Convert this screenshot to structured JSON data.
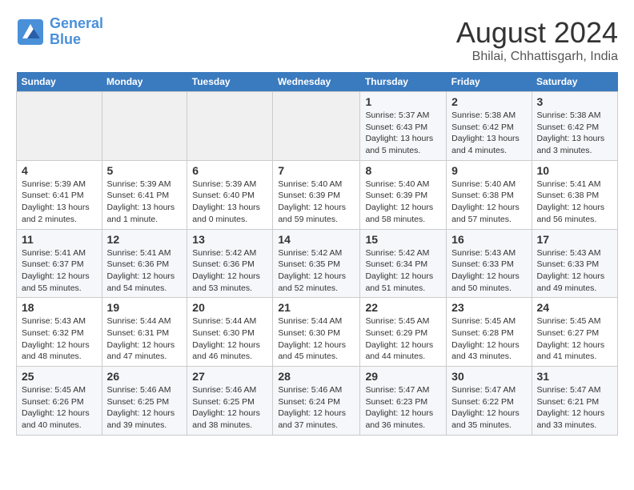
{
  "header": {
    "logo_line1": "General",
    "logo_line2": "Blue",
    "title": "August 2024",
    "subtitle": "Bhilai, Chhattisgarh, India"
  },
  "days_of_week": [
    "Sunday",
    "Monday",
    "Tuesday",
    "Wednesday",
    "Thursday",
    "Friday",
    "Saturday"
  ],
  "weeks": [
    [
      {
        "day": "",
        "info": ""
      },
      {
        "day": "",
        "info": ""
      },
      {
        "day": "",
        "info": ""
      },
      {
        "day": "",
        "info": ""
      },
      {
        "day": "1",
        "info": "Sunrise: 5:37 AM\nSunset: 6:43 PM\nDaylight: 13 hours\nand 5 minutes."
      },
      {
        "day": "2",
        "info": "Sunrise: 5:38 AM\nSunset: 6:42 PM\nDaylight: 13 hours\nand 4 minutes."
      },
      {
        "day": "3",
        "info": "Sunrise: 5:38 AM\nSunset: 6:42 PM\nDaylight: 13 hours\nand 3 minutes."
      }
    ],
    [
      {
        "day": "4",
        "info": "Sunrise: 5:39 AM\nSunset: 6:41 PM\nDaylight: 13 hours\nand 2 minutes."
      },
      {
        "day": "5",
        "info": "Sunrise: 5:39 AM\nSunset: 6:41 PM\nDaylight: 13 hours\nand 1 minute."
      },
      {
        "day": "6",
        "info": "Sunrise: 5:39 AM\nSunset: 6:40 PM\nDaylight: 13 hours\nand 0 minutes."
      },
      {
        "day": "7",
        "info": "Sunrise: 5:40 AM\nSunset: 6:39 PM\nDaylight: 12 hours\nand 59 minutes."
      },
      {
        "day": "8",
        "info": "Sunrise: 5:40 AM\nSunset: 6:39 PM\nDaylight: 12 hours\nand 58 minutes."
      },
      {
        "day": "9",
        "info": "Sunrise: 5:40 AM\nSunset: 6:38 PM\nDaylight: 12 hours\nand 57 minutes."
      },
      {
        "day": "10",
        "info": "Sunrise: 5:41 AM\nSunset: 6:38 PM\nDaylight: 12 hours\nand 56 minutes."
      }
    ],
    [
      {
        "day": "11",
        "info": "Sunrise: 5:41 AM\nSunset: 6:37 PM\nDaylight: 12 hours\nand 55 minutes."
      },
      {
        "day": "12",
        "info": "Sunrise: 5:41 AM\nSunset: 6:36 PM\nDaylight: 12 hours\nand 54 minutes."
      },
      {
        "day": "13",
        "info": "Sunrise: 5:42 AM\nSunset: 6:36 PM\nDaylight: 12 hours\nand 53 minutes."
      },
      {
        "day": "14",
        "info": "Sunrise: 5:42 AM\nSunset: 6:35 PM\nDaylight: 12 hours\nand 52 minutes."
      },
      {
        "day": "15",
        "info": "Sunrise: 5:42 AM\nSunset: 6:34 PM\nDaylight: 12 hours\nand 51 minutes."
      },
      {
        "day": "16",
        "info": "Sunrise: 5:43 AM\nSunset: 6:33 PM\nDaylight: 12 hours\nand 50 minutes."
      },
      {
        "day": "17",
        "info": "Sunrise: 5:43 AM\nSunset: 6:33 PM\nDaylight: 12 hours\nand 49 minutes."
      }
    ],
    [
      {
        "day": "18",
        "info": "Sunrise: 5:43 AM\nSunset: 6:32 PM\nDaylight: 12 hours\nand 48 minutes."
      },
      {
        "day": "19",
        "info": "Sunrise: 5:44 AM\nSunset: 6:31 PM\nDaylight: 12 hours\nand 47 minutes."
      },
      {
        "day": "20",
        "info": "Sunrise: 5:44 AM\nSunset: 6:30 PM\nDaylight: 12 hours\nand 46 minutes."
      },
      {
        "day": "21",
        "info": "Sunrise: 5:44 AM\nSunset: 6:30 PM\nDaylight: 12 hours\nand 45 minutes."
      },
      {
        "day": "22",
        "info": "Sunrise: 5:45 AM\nSunset: 6:29 PM\nDaylight: 12 hours\nand 44 minutes."
      },
      {
        "day": "23",
        "info": "Sunrise: 5:45 AM\nSunset: 6:28 PM\nDaylight: 12 hours\nand 43 minutes."
      },
      {
        "day": "24",
        "info": "Sunrise: 5:45 AM\nSunset: 6:27 PM\nDaylight: 12 hours\nand 41 minutes."
      }
    ],
    [
      {
        "day": "25",
        "info": "Sunrise: 5:45 AM\nSunset: 6:26 PM\nDaylight: 12 hours\nand 40 minutes."
      },
      {
        "day": "26",
        "info": "Sunrise: 5:46 AM\nSunset: 6:25 PM\nDaylight: 12 hours\nand 39 minutes."
      },
      {
        "day": "27",
        "info": "Sunrise: 5:46 AM\nSunset: 6:25 PM\nDaylight: 12 hours\nand 38 minutes."
      },
      {
        "day": "28",
        "info": "Sunrise: 5:46 AM\nSunset: 6:24 PM\nDaylight: 12 hours\nand 37 minutes."
      },
      {
        "day": "29",
        "info": "Sunrise: 5:47 AM\nSunset: 6:23 PM\nDaylight: 12 hours\nand 36 minutes."
      },
      {
        "day": "30",
        "info": "Sunrise: 5:47 AM\nSunset: 6:22 PM\nDaylight: 12 hours\nand 35 minutes."
      },
      {
        "day": "31",
        "info": "Sunrise: 5:47 AM\nSunset: 6:21 PM\nDaylight: 12 hours\nand 33 minutes."
      }
    ]
  ]
}
